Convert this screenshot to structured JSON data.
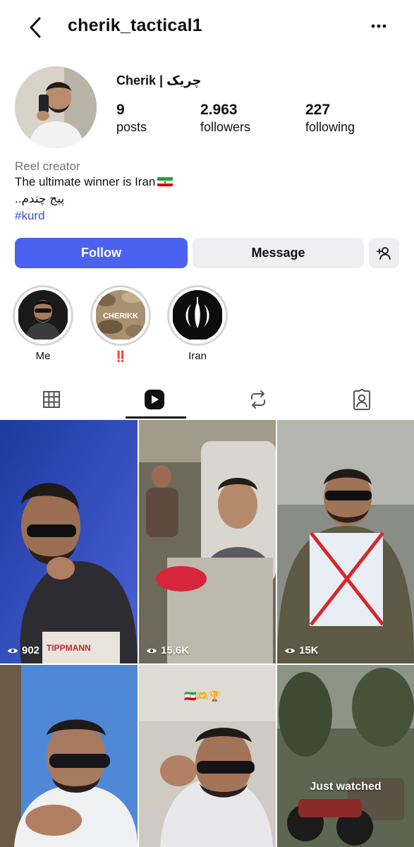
{
  "header": {
    "username": "cherik_tactical1",
    "back_icon": "chevron-left-icon",
    "more_icon": "more-horizontal-icon"
  },
  "profile": {
    "display_name": "Cherik | چریک",
    "stats": {
      "posts": {
        "value": "9",
        "label": "posts"
      },
      "followers": {
        "value": "2.963",
        "label": "followers"
      },
      "following": {
        "value": "227",
        "label": "following"
      }
    },
    "bio": {
      "category": "Reel creator",
      "line1": "The ultimate winner is Iran",
      "line2": "پیج چندم..",
      "hashtag": "#kurd"
    }
  },
  "actions": {
    "follow_label": "Follow",
    "message_label": "Message",
    "add_user_icon": "add-user-icon"
  },
  "highlights": [
    {
      "caption": "Me"
    },
    {
      "caption": "‼️",
      "badge_text": "CHERIKK"
    },
    {
      "caption": "Iran"
    }
  ],
  "tabs": [
    {
      "icon": "grid-icon"
    },
    {
      "icon": "reels-icon",
      "active": true
    },
    {
      "icon": "repost-icon"
    },
    {
      "icon": "tagged-icon"
    }
  ],
  "reels": [
    {
      "views": "902",
      "overlay_text": "TIPPMANN"
    },
    {
      "views": "15,6K"
    },
    {
      "views": "15K"
    },
    {},
    {
      "emoji_text": "🇮🇷🫶🏆"
    },
    {
      "status": "Just watched"
    }
  ],
  "colors": {
    "follow_button": "#4b62f0",
    "secondary_button": "#efeff2",
    "hashtag": "#3c4fcf",
    "muted_text": "#737373"
  }
}
